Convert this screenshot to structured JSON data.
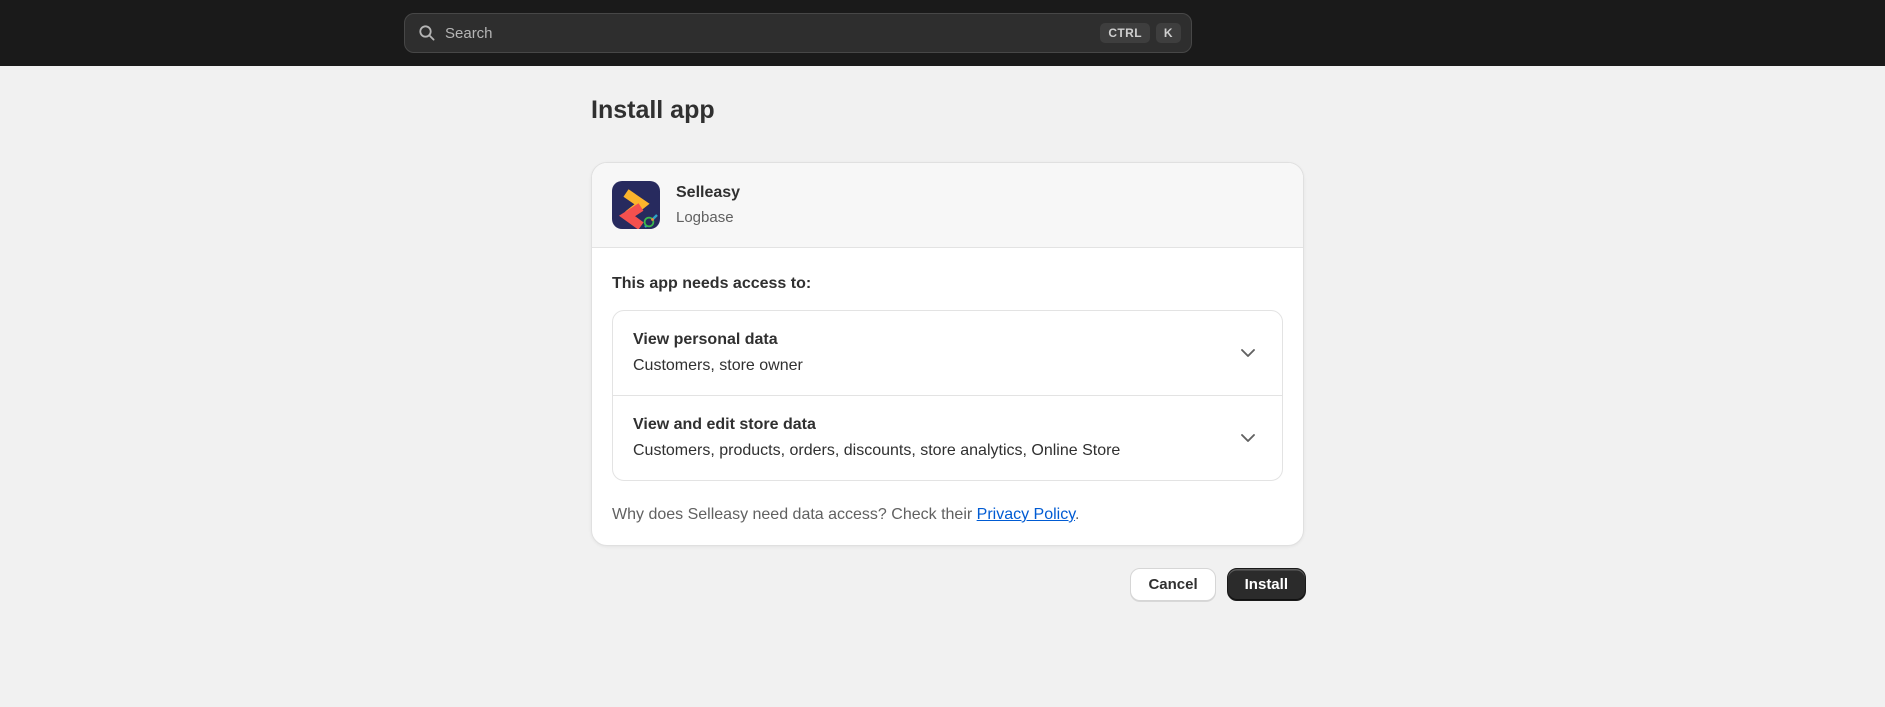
{
  "header": {
    "search": {
      "placeholder": "Search",
      "keys": [
        "CTRL",
        "K"
      ]
    }
  },
  "page": {
    "title": "Install app"
  },
  "card": {
    "app": {
      "name": "Selleasy",
      "developer": "Logbase"
    },
    "access_heading": "This app needs access to:",
    "permissions": [
      {
        "title": "View personal data",
        "details": "Customers, store owner"
      },
      {
        "title": "View and edit store data",
        "details": "Customers, products, orders, discounts, store analytics, Online Store"
      }
    ],
    "footer": {
      "prefix": "Why does Selleasy need data access? Check their ",
      "link_label": "Privacy Policy",
      "suffix": "."
    }
  },
  "actions": {
    "cancel_label": "Cancel",
    "install_label": "Install"
  },
  "colors": {
    "topbar_bg": "#1a1a1a",
    "page_bg": "#f1f1f1",
    "link_blue": "#005BD3",
    "text_primary": "#303030",
    "text_secondary": "#616161",
    "app_icon_navy": "#272a5e",
    "app_icon_yellow": "#fbb42c",
    "app_icon_red": "#f4504e",
    "install_button_bg": "#2b2b2b"
  }
}
